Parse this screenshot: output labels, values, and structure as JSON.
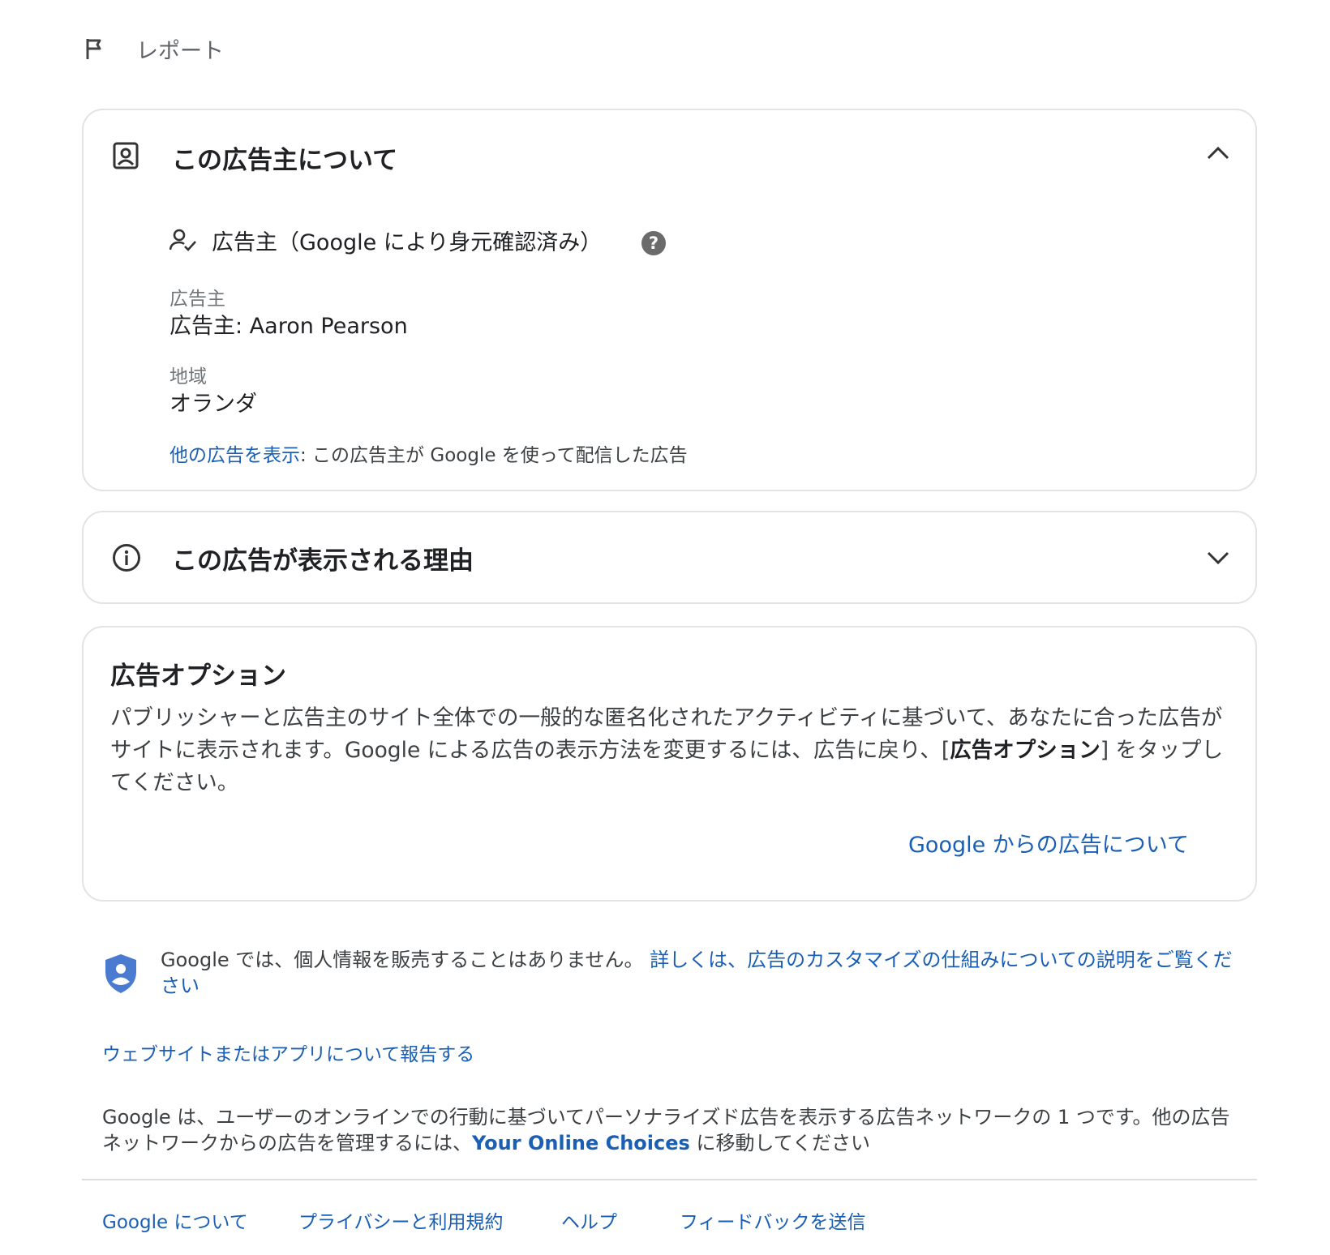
{
  "header": {
    "report_label": "レポート"
  },
  "advertiser_card": {
    "title": "この広告主について",
    "verified_label": "広告主（Google により身元確認済み）",
    "advertiser_field_label": "広告主",
    "advertiser_value": "広告主: Aaron Pearson",
    "region_field_label": "地域",
    "region_value": "オランダ",
    "more_ads_link": "他の広告を表示",
    "more_ads_desc": ": この広告主が Google を使って配信した広告"
  },
  "reason_card": {
    "title": "この広告が表示される理由"
  },
  "options_card": {
    "title": "広告オプション",
    "body_pre": "パブリッシャーと広告主のサイト全体での一般的な匿名化されたアクティビティに基づいて、あなたに合った広告がサイトに表示されます。Google による広告の表示方法を変更するには、広告に戻り、[",
    "body_bold": "広告オプション",
    "body_post": "] をタップしてください。",
    "about_link": "Google からの広告について"
  },
  "privacy": {
    "text": "Google では、個人情報を販売することはありません。",
    "link": "詳しくは、広告のカスタマイズの仕組みについての説明をご覧ください"
  },
  "report_site_link": "ウェブサイトまたはアプリについて報告する",
  "network_note": {
    "text_pre": "Google は、ユーザーのオンラインでの行動に基づいてパーソナライズド広告を表示する広告ネットワークの 1 つです。他の広告ネットワークからの広告を管理するには、",
    "link": "Your Online Choices",
    "text_post": " に移動してください"
  },
  "footer": {
    "links": [
      "Google について",
      "プライバシーと利用規約",
      "ヘルプ",
      "フィードバックを送信"
    ]
  },
  "colors": {
    "link": "#1a5fb4",
    "shield": "#4a7bd0",
    "help_badge": "#6b6b6b",
    "divider": "#dadce0"
  },
  "icons": [
    "flag-icon",
    "account-box-icon",
    "chevron-up-icon",
    "person-check-icon",
    "help-icon",
    "info-icon",
    "chevron-down-icon",
    "shield-person-icon"
  ]
}
